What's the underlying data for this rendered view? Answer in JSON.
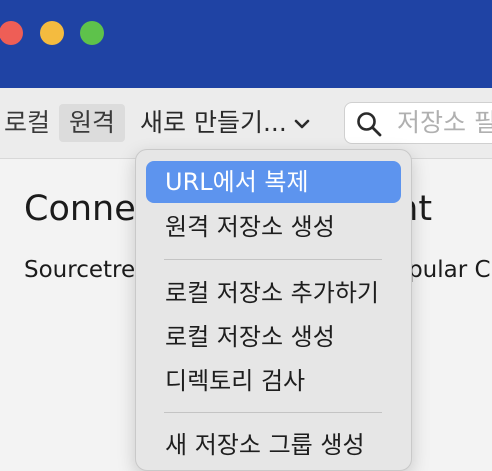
{
  "toolbar": {
    "local_tab": "로컬",
    "remote_tab": "원격",
    "new_menu_label": "새로 만들기...",
    "search_placeholder": "저장소 필"
  },
  "main": {
    "heading": "Connect",
    "heading_tail": "unt",
    "body": "Sourcetre",
    "body_tail": "opular C"
  },
  "menu": {
    "items": [
      "URL에서 복제",
      "원격 저장소 생성",
      "로컬 저장소 추가하기",
      "로컬 저장소 생성",
      "디렉토리 검사",
      "새 저장소 그룹 생성"
    ]
  },
  "colors": {
    "titlebar": "#1f43a4",
    "menu_highlight": "#5d94ee"
  },
  "icons": [
    "chevron-down-icon",
    "search-icon"
  ]
}
